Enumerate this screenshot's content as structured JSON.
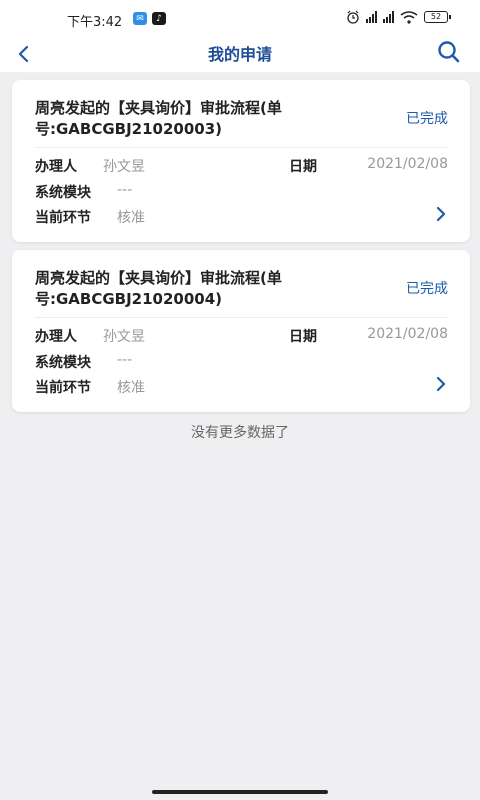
{
  "status_bar": {
    "time": "下午3:42",
    "battery": "52"
  },
  "nav": {
    "title": "我的申请"
  },
  "labels": {
    "handler": "办理人",
    "date": "日期",
    "module": "系统模块",
    "current_step": "当前环节"
  },
  "applications": [
    {
      "title": "周亮发起的【夹具询价】审批流程(单号:GABCGBJ21020003)",
      "status": "已完成",
      "handler": "孙文昱",
      "date": "2021/02/08",
      "module": "---",
      "current_step": "核准"
    },
    {
      "title": "周亮发起的【夹具询价】审批流程(单号:GABCGBJ21020004)",
      "status": "已完成",
      "handler": "孙文昱",
      "date": "2021/02/08",
      "module": "---",
      "current_step": "核准"
    }
  ],
  "footer": {
    "no_more": "没有更多数据了"
  },
  "colors": {
    "accent": "#1c5ba8",
    "title": "#1c4e95",
    "background": "#efeff1"
  },
  "icons": [
    "back-icon",
    "search-icon",
    "chevron-right-icon",
    "alarm-icon",
    "wifi-icon",
    "battery-icon"
  ]
}
